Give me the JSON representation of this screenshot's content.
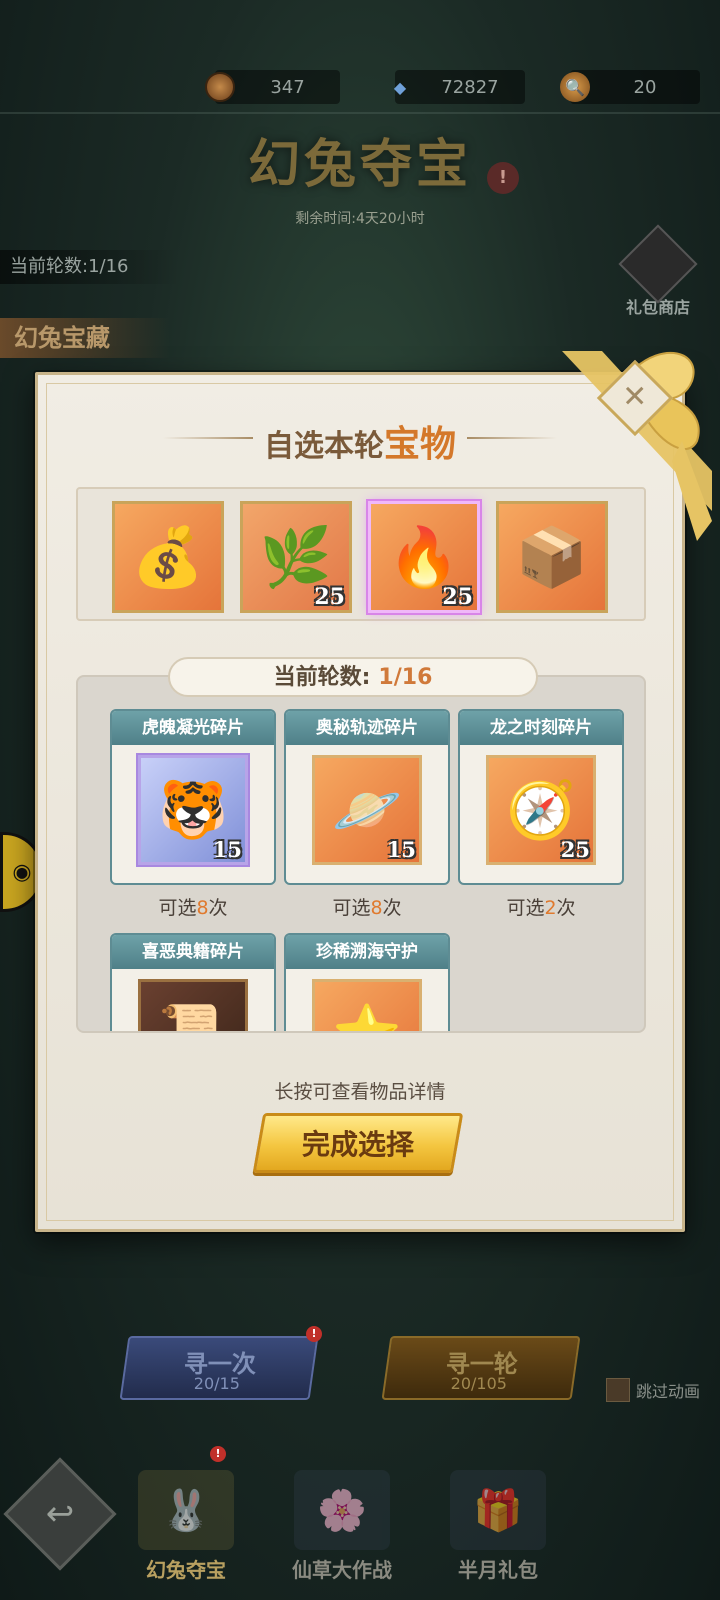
{
  "currencies": [
    {
      "icon": "coin-icon",
      "value": "347"
    },
    {
      "icon": "diamond-icon",
      "value": "72827"
    },
    {
      "icon": "magnifier-key-icon",
      "value": "20"
    }
  ],
  "event": {
    "title": "幻兔夺宝",
    "info_mark": "!",
    "remaining": "剩余时间:4天20小时",
    "current_round_label": "当前轮数:1/16",
    "treasure_label": "幻兔宝藏",
    "gift_shop_label": "礼包商店"
  },
  "modal": {
    "title_prefix": "自选本轮",
    "title_highlight": "宝物",
    "close_glyph": "✕",
    "selected_items": [
      {
        "name": "lucky-bag",
        "glyph": "💰",
        "count": ""
      },
      {
        "name": "tangled-vines",
        "glyph": "🌿",
        "count": "25"
      },
      {
        "name": "fire-box",
        "glyph": "🔥",
        "count": "25"
      },
      {
        "name": "gold-chest",
        "glyph": "📦",
        "count": ""
      }
    ],
    "round_banner_label": "当前轮数:",
    "round_banner_value": "1/16",
    "pool": [
      {
        "title": "虎魄凝光碎片",
        "glyph": "🐯",
        "count": "15",
        "avail_prefix": "可选",
        "avail_num": "8",
        "avail_suffix": "次"
      },
      {
        "title": "奥秘轨迹碎片",
        "glyph": "🪐",
        "count": "15",
        "avail_prefix": "可选",
        "avail_num": "8",
        "avail_suffix": "次"
      },
      {
        "title": "龙之时刻碎片",
        "glyph": "🧭",
        "count": "25",
        "avail_prefix": "可选",
        "avail_num": "2",
        "avail_suffix": "次"
      },
      {
        "title": "喜恶典籍碎片",
        "glyph": "📜"
      },
      {
        "title": "珍稀溯海守护",
        "glyph": "⭐"
      }
    ],
    "hint": "长按可查看物品详情",
    "confirm_label": "完成选择"
  },
  "actions": {
    "once_label": "寻一次",
    "once_count": "20/15",
    "round_label": "寻一轮",
    "round_count": "20/105",
    "skip_label": "跳过动画",
    "red_dot": "!"
  },
  "nav": [
    {
      "label": "幻兔夺宝",
      "glyph": "🐰"
    },
    {
      "label": "仙草大作战",
      "glyph": "🌸"
    },
    {
      "label": "半月礼包",
      "glyph": "🎁"
    }
  ]
}
